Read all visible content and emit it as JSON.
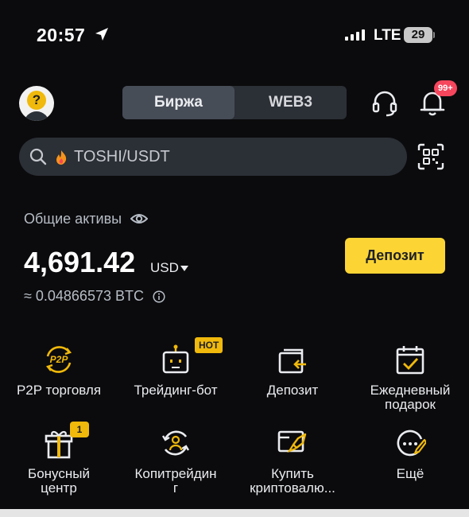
{
  "status_bar": {
    "time": "20:57",
    "network": "LTE",
    "battery": "29"
  },
  "header": {
    "tabs": [
      {
        "label": "Биржа"
      },
      {
        "label": "WEB3"
      }
    ],
    "notifications_badge": "99+"
  },
  "search": {
    "text": "TOSHI/USDT"
  },
  "assets": {
    "label": "Общие активы",
    "balance": "4,691.42",
    "currency": "USD",
    "btc_equivalent": "≈ 0.04866573 BTC",
    "deposit_button": "Депозит"
  },
  "shortcuts": [
    {
      "label": "P2P торговля",
      "icon": "p2p-icon"
    },
    {
      "label": "Трейдинг-бот",
      "icon": "trading-bot-icon",
      "badge": "HOT"
    },
    {
      "label": "Депозит",
      "icon": "deposit-icon"
    },
    {
      "label": "Ежедневный\nподарок",
      "icon": "calendar-check-icon"
    },
    {
      "label": "Бонусный\nцентр",
      "icon": "gift-icon",
      "badge": "1"
    },
    {
      "label": "Копитрейдин\nг",
      "icon": "copy-trading-icon"
    },
    {
      "label": "Купить\nкриптовалю...",
      "icon": "buy-crypto-icon"
    },
    {
      "label": "Ещё",
      "icon": "more-icon"
    }
  ],
  "colors": {
    "accent": "#FCD535",
    "badge_yellow": "#F0B90B",
    "badge_red": "#F6465D",
    "background": "#0B0B0D",
    "surface": "#2B2F36"
  }
}
